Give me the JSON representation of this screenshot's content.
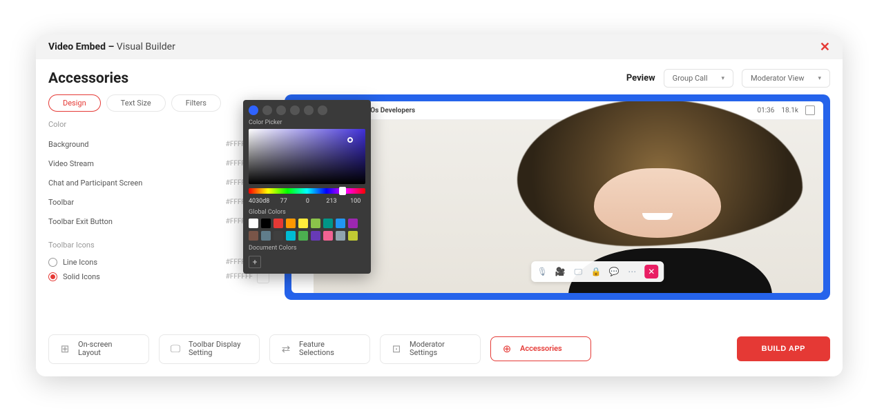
{
  "colors": {
    "accent": "#e53935",
    "preview_frame": "#2563eb"
  },
  "topbar": {
    "title_bold": "Video Embed –",
    "title_rest": " Visual Builder"
  },
  "header": {
    "title": "Accessories",
    "preview_label": "Peview",
    "select1": "Group Call",
    "select2": "Moderator View"
  },
  "tabs": [
    "Design",
    "Text Size",
    "Filters"
  ],
  "side": {
    "group_color": "Color",
    "rows": [
      {
        "label": "Background",
        "hex": "#FFFFFF"
      },
      {
        "label": "Video Stream",
        "hex": "#FFFFFF"
      },
      {
        "label": "Chat and Participant Screen",
        "hex": "#FFFFFF"
      },
      {
        "label": "Toolbar",
        "hex": "#FFFFFF"
      },
      {
        "label": "Toolbar Exit Button",
        "hex": "#FFFFFF"
      }
    ],
    "group_icons": "Toolbar Icons",
    "radio1": "Line Icons",
    "radio2": "Solid Icons",
    "icon_hex": "#FFFFFF"
  },
  "preview": {
    "meeting_title": "Kick-off Meeting with iOs Developers",
    "timer": "01:36",
    "count": "18.1k"
  },
  "picker": {
    "title": "Color Picker",
    "hex": "4030d8",
    "r": "77",
    "g": "0",
    "b": "213",
    "a": "100",
    "global_label": "Global Colors",
    "doc_label": "Document Colors",
    "swatches": [
      "#ffffff",
      "#000000",
      "#e53935",
      "#ff9800",
      "#ffeb3b",
      "#8bc34a",
      "#009688",
      "#2196f3",
      "#9c27b0",
      "#795548",
      "#607d8b",
      "#3f3f3f",
      "#00bcd4",
      "#4caf50",
      "#673ab7",
      "#f06292",
      "#90a4ae",
      "#c0ca33"
    ]
  },
  "bottom": {
    "nav": [
      {
        "label": "On-screen\nLayout",
        "icon": "⊞"
      },
      {
        "label": "Toolbar Display\nSetting",
        "icon": "🖵"
      },
      {
        "label": "Feature\nSelections",
        "icon": "⇄"
      },
      {
        "label": "Moderator\nSettings",
        "icon": "⊡"
      },
      {
        "label": "Accessories",
        "icon": "⊕"
      }
    ],
    "build": "BUILD APP"
  }
}
